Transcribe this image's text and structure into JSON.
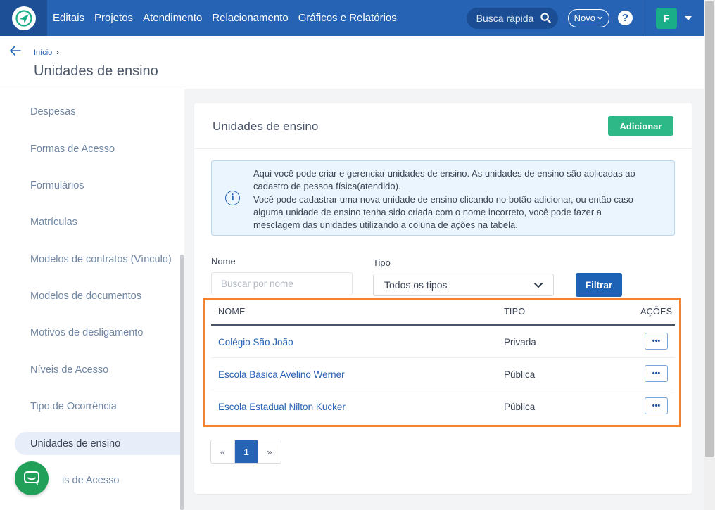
{
  "navbar": {
    "items": [
      "Editais",
      "Projetos",
      "Atendimento",
      "Relacionamento",
      "Gráficos e Relatórios"
    ],
    "search_label": "Busca rápida",
    "novo_label": "Novo",
    "help_label": "?",
    "avatar_initial": "F",
    "colors": {
      "bar": "#2763b4",
      "logo_bg": "#1d4f97",
      "avatar": "#1aae88"
    }
  },
  "header": {
    "breadcrumb_home": "Início",
    "breadcrumb_sep": "›",
    "page_title": "Unidades de ensino"
  },
  "sidebar": {
    "items": [
      "Despesas",
      "Formas de Acesso",
      "Formulários",
      "Matrículas",
      "Modelos de contratos (Vínculo)",
      "Modelos de documentos",
      "Motivos de desligamento",
      "Níveis de Acesso",
      "Tipo de Ocorrência",
      "Unidades de ensino",
      "is de Acesso"
    ],
    "active_item": "Unidades de ensino"
  },
  "card": {
    "title": "Unidades de ensino",
    "add_button": "Adicionar",
    "info_lines": [
      "Aqui você pode criar e gerenciar unidades de ensino. As unidades de ensino são aplicadas ao",
      "cadastro de pessoa física(atendido).",
      "Você pode cadastrar uma nova unidade de ensino clicando no botão adicionar, ou então caso",
      "alguma unidade de ensino tenha sido criada com o nome incorreto, você pode fazer a",
      "mesclagem das unidades utilizando a coluna de ações na tabela."
    ],
    "filters": {
      "name_label": "Nome",
      "name_placeholder": "Buscar por nome",
      "type_label": "Tipo",
      "type_selected": "Todos os tipos",
      "filter_button": "Filtrar"
    },
    "table": {
      "headers": {
        "name": "NOME",
        "type": "TIPO",
        "actions": "AÇÕES"
      },
      "rows": [
        {
          "name": "Colégio São João",
          "type": "Privada",
          "actions": "•••"
        },
        {
          "name": "Escola Básica Avelino Werner",
          "type": "Pública",
          "actions": "•••"
        },
        {
          "name": "Escola Estadual Nilton Kucker",
          "type": "Pública",
          "actions": "•••"
        }
      ]
    },
    "pagination": {
      "prev": "«",
      "current": "1",
      "next": "»"
    },
    "colors": {
      "add_button": "#2fb887",
      "filter_button": "#1d62b5",
      "highlight": "#f6812f",
      "link": "#2763b4"
    }
  }
}
